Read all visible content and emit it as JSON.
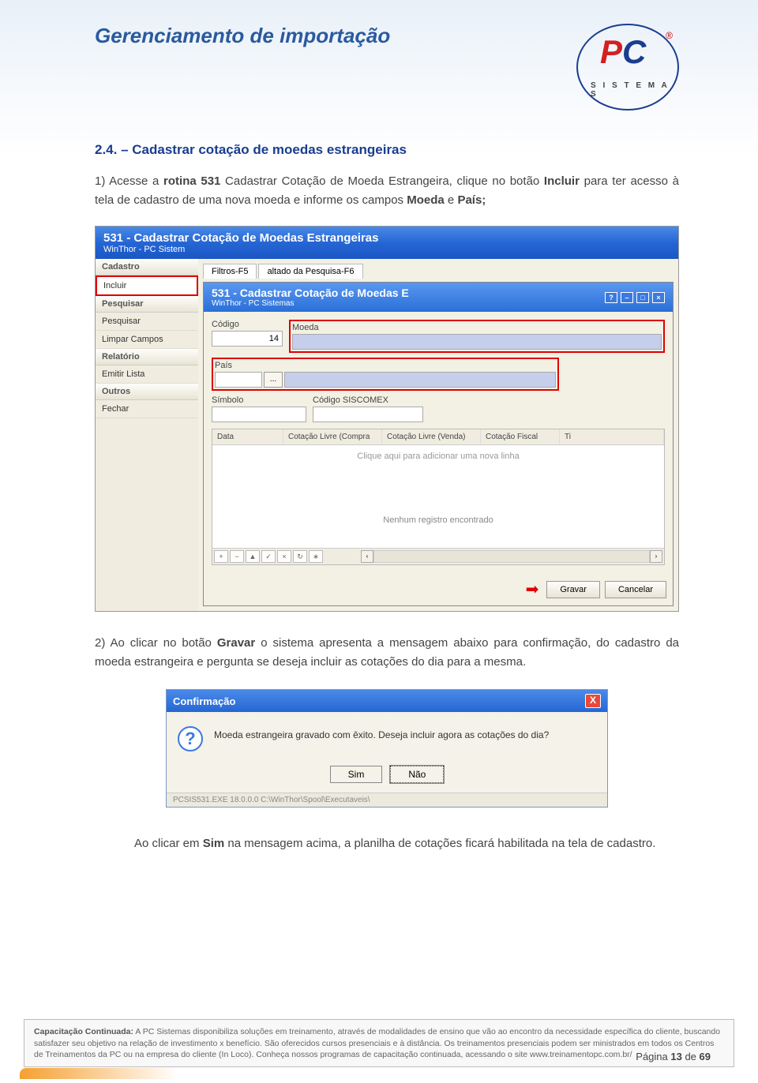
{
  "header": {
    "title": "Gerenciamento de importação"
  },
  "logo": {
    "p": "P",
    "c": "C",
    "r": "®",
    "sub": "S I S T E M A S"
  },
  "section": {
    "heading": "2.4. – Cadastrar cotação de moedas estrangeiras"
  },
  "para1_prefix": "1)  Acesse a ",
  "para1_rotina": "rotina 531",
  "para1_mid": " Cadastrar Cotação de Moeda Estrangeira, clique no botão ",
  "para1_incluir": "Incluir",
  "para1_rest": " para ter acesso à tela de cadastro de uma nova moeda e informe os campos ",
  "para1_moeda": "Moeda",
  "para1_e": " e ",
  "para1_pais": "País;",
  "win1": {
    "title": "531 - Cadastrar Cotação de Moedas Estrangeiras",
    "subtitle": "WinThor - PC Sistem",
    "sidebar": {
      "groups": [
        {
          "head": "Cadastro",
          "items": [
            "Incluir"
          ]
        },
        {
          "head": "Pesquisar",
          "items": [
            "Pesquisar",
            "Limpar Campos"
          ]
        },
        {
          "head": "Relatório",
          "items": [
            "Emitir Lista"
          ]
        },
        {
          "head": "Outros",
          "items": [
            "Fechar"
          ]
        }
      ]
    },
    "tabs": [
      "Filtros-F5",
      "altado da Pesquisa-F6"
    ],
    "inner": {
      "title": "531 - Cadastrar Cotação de Moedas E",
      "subtitle": "WinThor - PC Sistemas",
      "labels": {
        "codigo": "Código",
        "moeda": "Moeda",
        "pais": "País",
        "simbolo": "Símbolo",
        "siscomex": "Código SISCOMEX"
      },
      "codigo_value": "14",
      "lookup": "...",
      "grid_cols": [
        "Data",
        "Cotação Livre (Compra",
        "Cotação Livre (Venda)",
        "Cotação Fiscal",
        "Ti"
      ],
      "grid_hint": "Clique aqui para adicionar uma nova linha",
      "grid_empty": "Nenhum registro encontrado",
      "tools": [
        "+",
        "−",
        "▲",
        "✓",
        "×",
        "↻",
        "∗"
      ],
      "scroll_l": "‹",
      "scroll_r": "›",
      "btn_gravar": "Gravar",
      "btn_cancelar": "Cancelar"
    }
  },
  "para2_prefix": "2)  Ao clicar no botão ",
  "para2_gravar": "Gravar",
  "para2_rest": " o sistema apresenta a mensagem abaixo para confirmação, do cadastro da moeda estrangeira e pergunta se deseja incluir as cotações do dia para a mesma.",
  "dialog": {
    "title": "Confirmação",
    "close": "X",
    "icon": "?",
    "text": "Moeda estrangeira gravado com êxito. Deseja incluir agora as cotações do dia?",
    "sim": "Sim",
    "nao": "Não",
    "status": "PCSIS531.EXE 18.0.0.0 C:\\WinThor\\Spool\\Executaveis\\"
  },
  "para3_prefix": "Ao clicar em ",
  "para3_sim": "Sim",
  "para3_rest": " na mensagem acima, a planilha de cotações ficará habilitada na tela de cadastro.",
  "footer": {
    "bold": "Capacitação Continuada:",
    "text": " A PC Sistemas disponibiliza soluções em treinamento, através de modalidades de ensino que vão ao encontro da necessidade específica do cliente, buscando satisfazer seu objetivo na relação de investimento x benefício. São oferecidos cursos presenciais e à distância. Os treinamentos presenciais podem ser ministrados em todos os Centros de Treinamentos da PC ou na empresa do cliente (In Loco). Conheça nossos programas de capacitação continuada, acessando o site www.treinamentopc.com.br/"
  },
  "page": {
    "label": "Página ",
    "num": "13",
    "of": " de ",
    "total": "69"
  }
}
